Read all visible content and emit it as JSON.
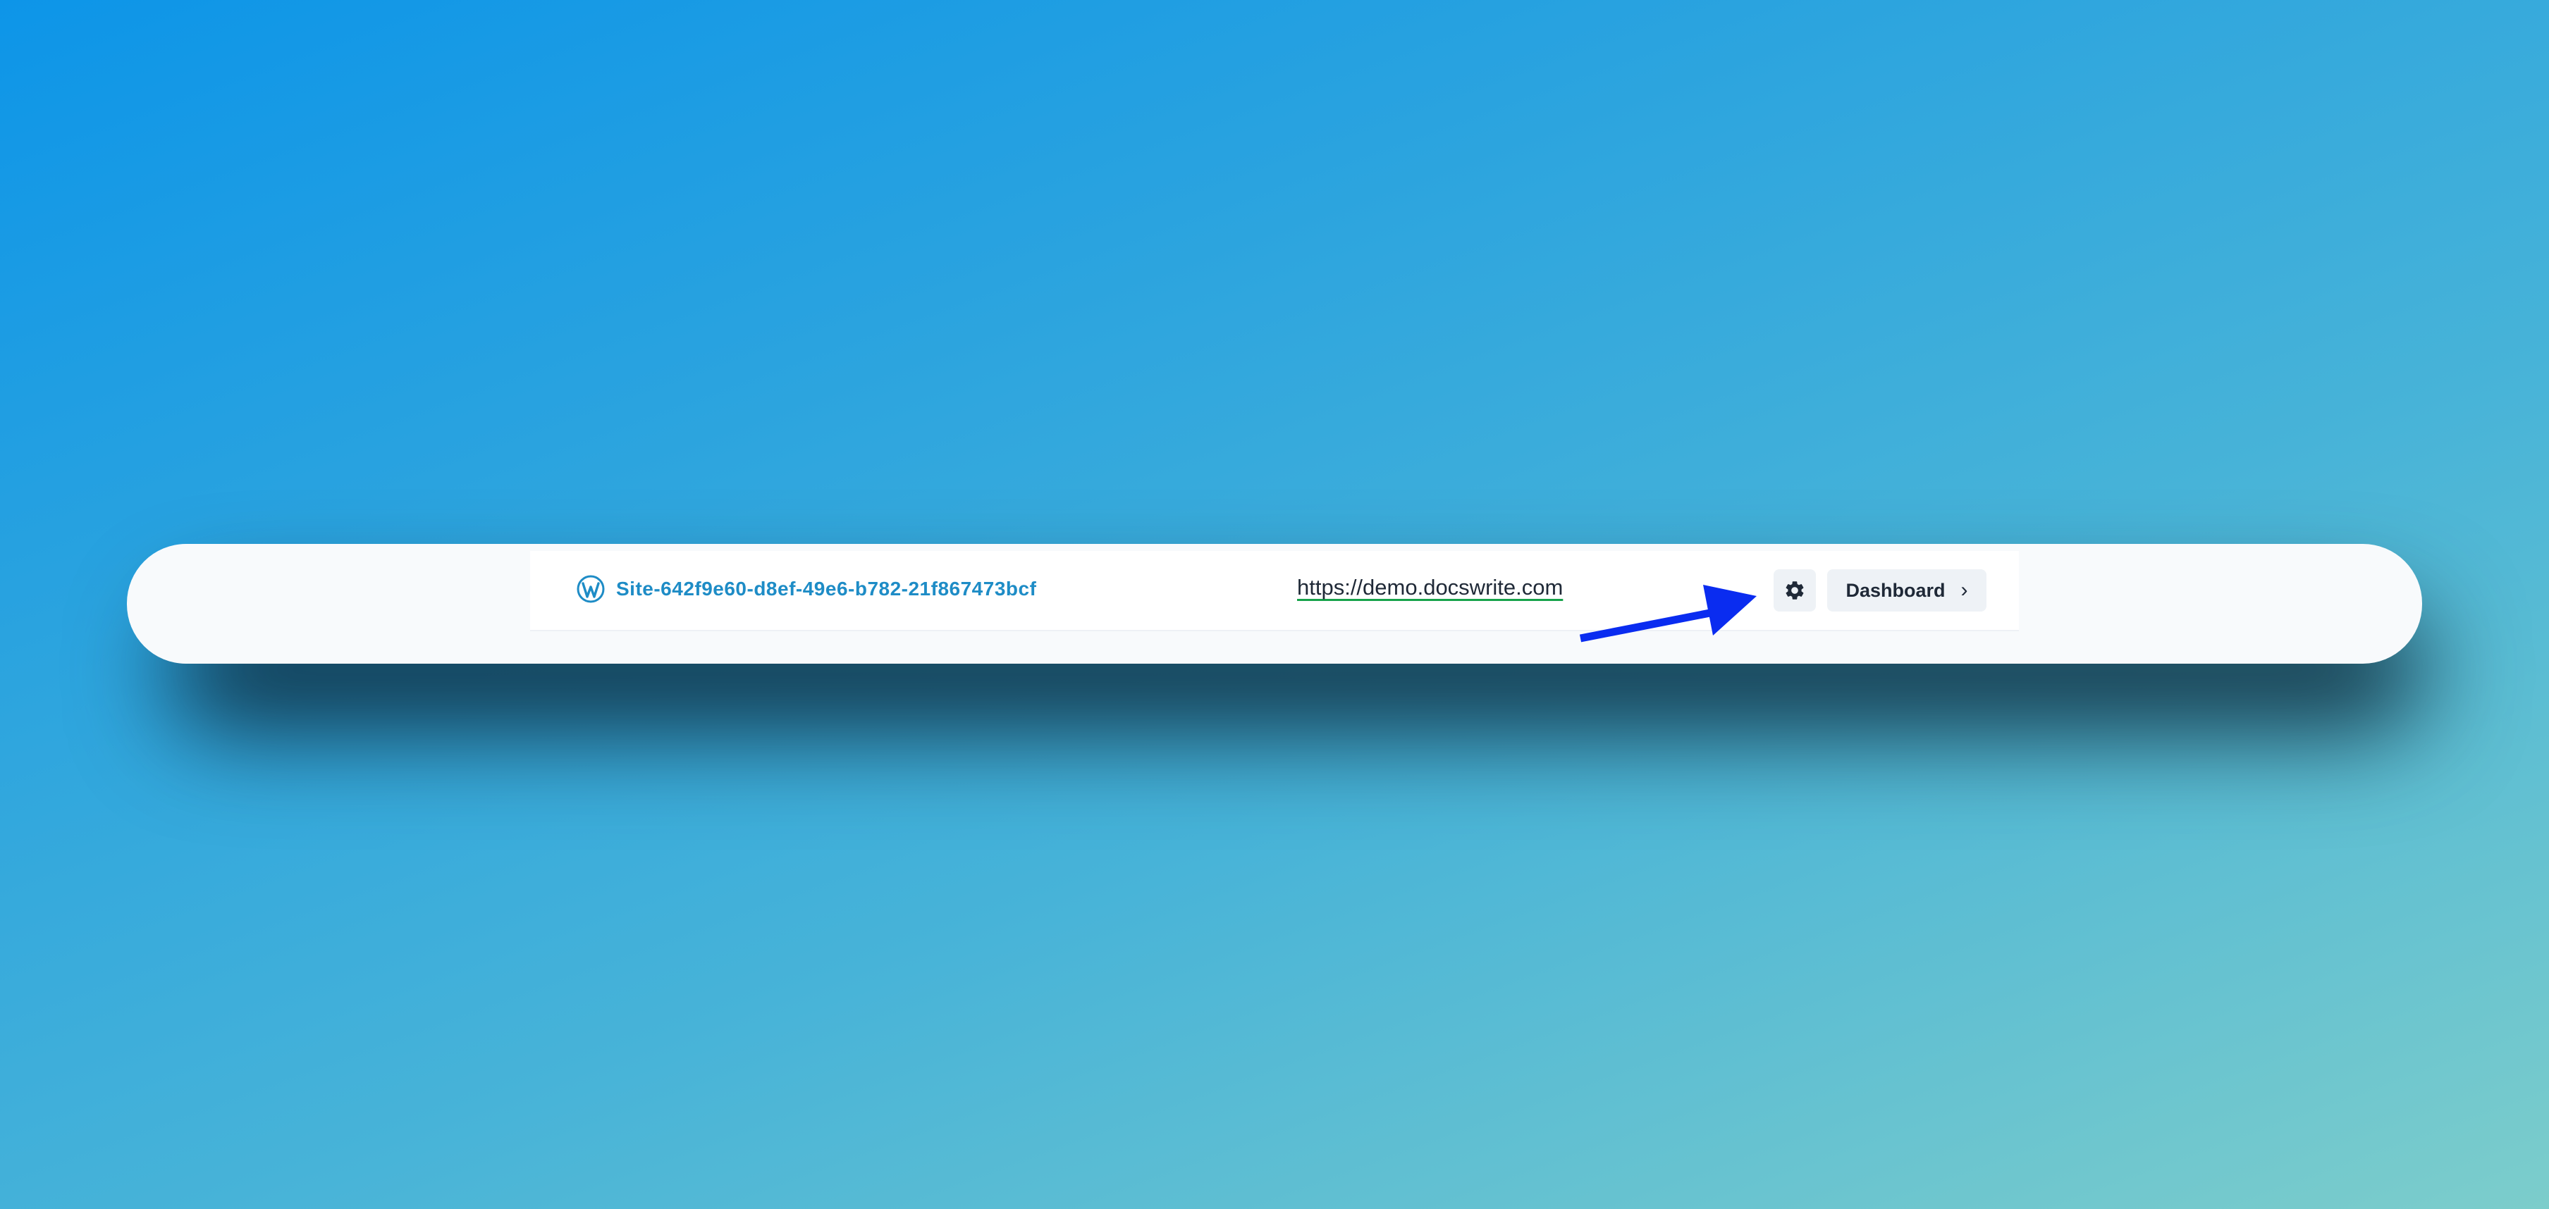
{
  "site": {
    "name": "Site-642f9e60-d8ef-49e6-b782-21f867473bcf",
    "icon": "wordpress-icon"
  },
  "url": {
    "text": "https://demo.docswrite.com"
  },
  "actions": {
    "settings_icon": "gear-icon",
    "dashboard_label": "Dashboard",
    "dashboard_icon": "chevron-right-icon"
  },
  "annotation": {
    "type": "arrow",
    "color": "#0a2cf0"
  },
  "colors": {
    "site_link": "#1e8cc6",
    "url_underline": "#16a34a",
    "button_bg": "#eef2f6",
    "text_dark": "#1f2937"
  }
}
